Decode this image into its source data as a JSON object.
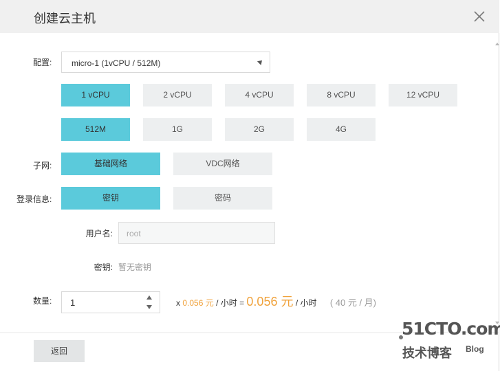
{
  "dialog": {
    "title": "创建云主机"
  },
  "config": {
    "label": "配置:",
    "select_value": "micro-1 (1vCPU / 512M)",
    "cpu_options": [
      "1 vCPU",
      "2 vCPU",
      "4 vCPU",
      "8 vCPU",
      "12 vCPU"
    ],
    "cpu_selected": "1 vCPU",
    "mem_options": [
      "512M",
      "1G",
      "2G",
      "4G"
    ],
    "mem_selected": "512M"
  },
  "subnet": {
    "label": "子网:",
    "options": [
      "基础网络",
      "VDC网络"
    ],
    "selected": "基础网络"
  },
  "login": {
    "label": "登录信息:",
    "options": [
      "密钥",
      "密码"
    ],
    "selected": "密钥",
    "username_label": "用户名:",
    "username_placeholder": "root",
    "key_label": "密钥:",
    "key_value": "暂无密钥"
  },
  "quantity": {
    "label": "数量:",
    "value": "1",
    "price_prefix": "x",
    "unit_price": "0.056 元",
    "per_hour": "/ 小时 =",
    "total_price": "0.056 元",
    "per_hour2": "/ 小时",
    "monthly": "( 40 元 / 月)"
  },
  "footer": {
    "back_label": "返回"
  },
  "watermark": {
    "site": "51CTO.com",
    "tagline": "技术博客",
    "blog": "Blog"
  },
  "colors": {
    "selected": "#5bcadb",
    "option": "#edeff0",
    "price": "#f0a23b"
  }
}
